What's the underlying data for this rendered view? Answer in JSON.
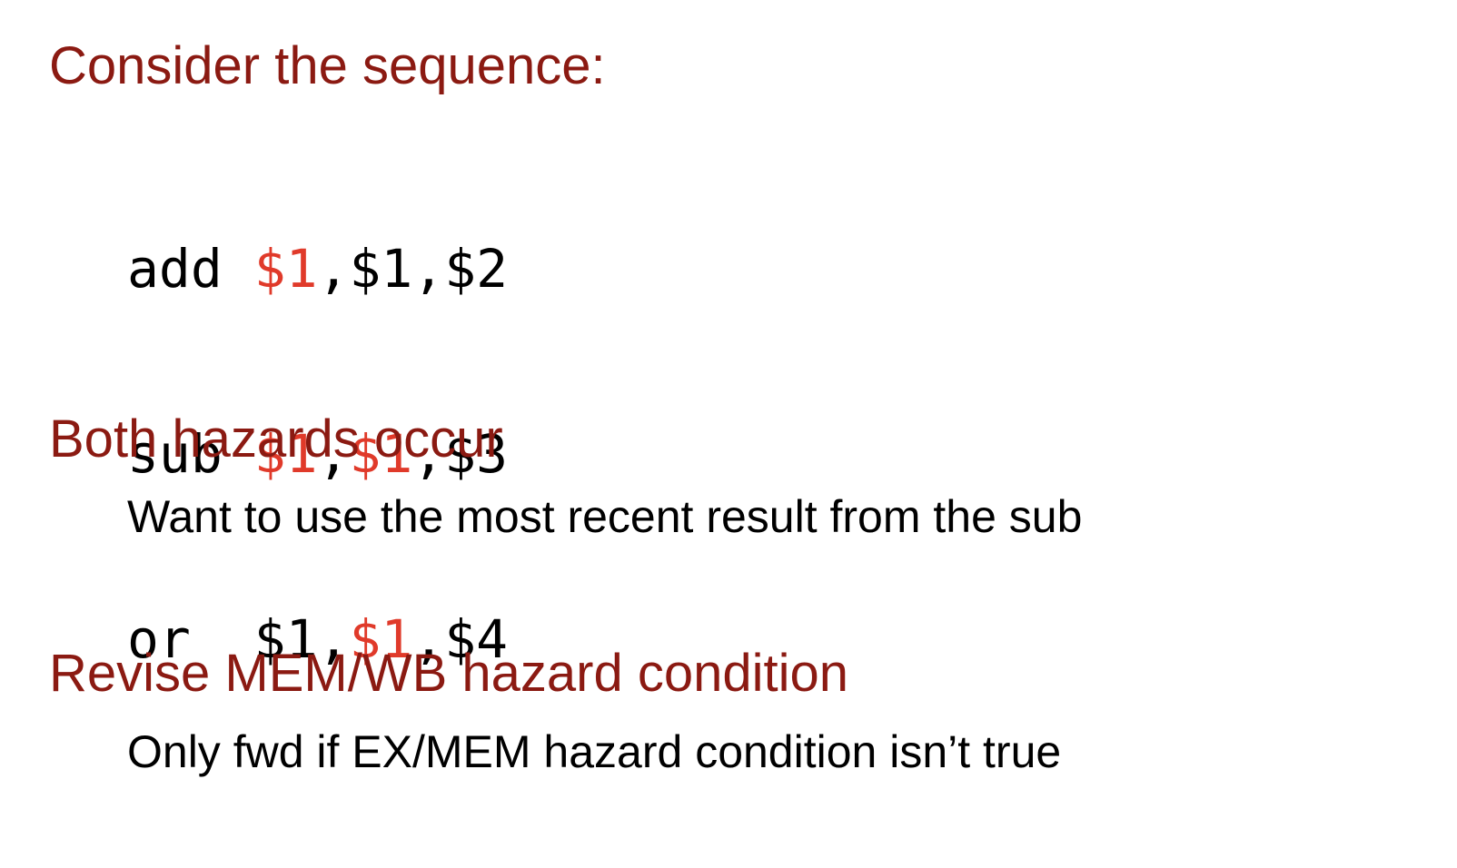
{
  "slide": {
    "heading1": "Consider the sequence:",
    "code": [
      [
        {
          "text": "add ",
          "highlight": false
        },
        {
          "text": "$1",
          "highlight": true
        },
        {
          "text": ",$1,$2",
          "highlight": false
        }
      ],
      [
        {
          "text": "sub ",
          "highlight": false
        },
        {
          "text": "$1",
          "highlight": true
        },
        {
          "text": ",",
          "highlight": false
        },
        {
          "text": "$1",
          "highlight": true
        },
        {
          "text": ",$3",
          "highlight": false
        }
      ],
      [
        {
          "text": "or  $1,",
          "highlight": false
        },
        {
          "text": "$1",
          "highlight": true
        },
        {
          "text": ",$4",
          "highlight": false
        }
      ]
    ],
    "heading2": "Both hazards occur",
    "text2": "Want to use the most recent result from the sub",
    "heading3": "Revise MEM/WB hazard condition",
    "text3": "Only fwd if EX/MEM hazard condition isn’t true",
    "colors": {
      "heading": "#8b1a12",
      "highlight": "#e03a2a",
      "text": "#000000"
    }
  }
}
